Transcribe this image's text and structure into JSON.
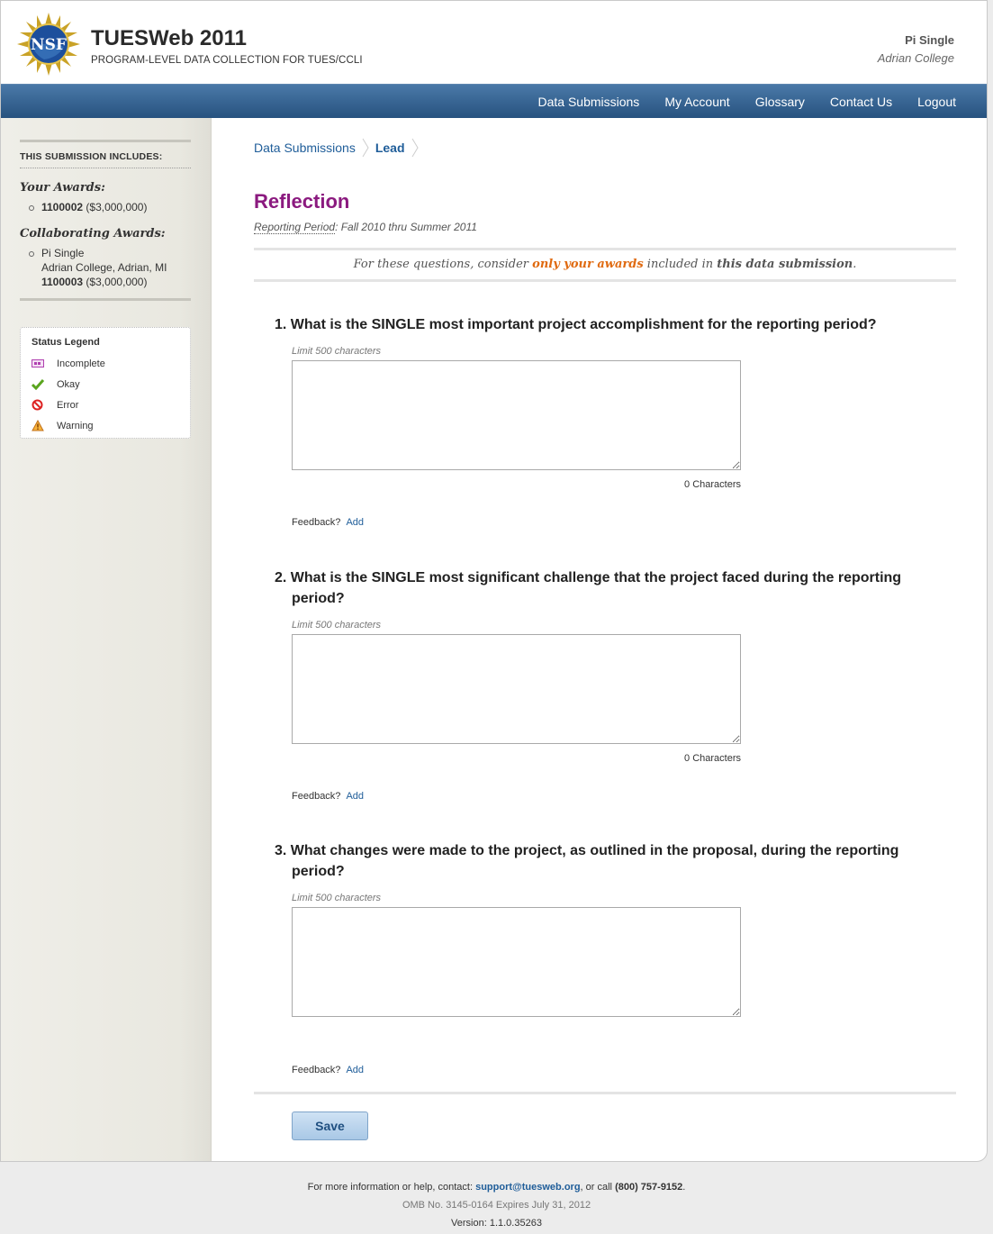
{
  "header": {
    "title": "TUESWeb 2011",
    "subtitle": "PROGRAM-LEVEL DATA COLLECTION FOR TUES/CCLI",
    "logo_text": "NSF",
    "user_name": "Pi Single",
    "user_org": "Adrian College"
  },
  "nav": {
    "items": [
      {
        "label": "Data Submissions"
      },
      {
        "label": "My Account"
      },
      {
        "label": "Glossary"
      },
      {
        "label": "Contact Us"
      },
      {
        "label": "Logout"
      }
    ]
  },
  "sidebar": {
    "heading": "THIS SUBMISSION INCLUDES:",
    "your_awards_title": "Your Awards:",
    "your_awards": [
      {
        "id": "1100002",
        "amount": "($3,000,000)"
      }
    ],
    "collab_title": "Collaborating Awards:",
    "collab_awards": [
      {
        "pi": "Pi Single",
        "location": "Adrian College, Adrian, MI",
        "id": "1100003",
        "amount": "($3,000,000)"
      }
    ],
    "legend": {
      "title": "Status Legend",
      "items": [
        {
          "label": "Incomplete",
          "icon": "incomplete-icon"
        },
        {
          "label": "Okay",
          "icon": "check-icon"
        },
        {
          "label": "Error",
          "icon": "error-icon"
        },
        {
          "label": "Warning",
          "icon": "warning-icon"
        }
      ]
    }
  },
  "breadcrumb": {
    "items": [
      {
        "label": "Data Submissions"
      },
      {
        "label": "Lead"
      }
    ]
  },
  "page": {
    "title": "Reflection",
    "period_label": "Reporting Period",
    "period_value": ": Fall 2010 thru Summer 2011",
    "notice": {
      "prefix": "For these questions, consider ",
      "highlight": "only your awards",
      "middle": " included in ",
      "emphasis": "this data submission",
      "suffix": "."
    }
  },
  "questions": [
    {
      "text": "1. What is the SINGLE most important project accomplishment for the reporting period?",
      "limit": "Limit 500 characters",
      "value": "",
      "char_count": "0 Characters",
      "feedback_label": "Feedback?",
      "feedback_action": "Add"
    },
    {
      "text": "2. What is the SINGLE most significant challenge that the project faced during the reporting period?",
      "limit": "Limit 500 characters",
      "value": "",
      "char_count": "0 Characters",
      "feedback_label": "Feedback?",
      "feedback_action": "Add"
    },
    {
      "text": "3. What changes were made to the project, as outlined in the proposal, during the reporting period?",
      "limit": "Limit 500 characters",
      "value": "",
      "char_count": "",
      "feedback_label": "Feedback?",
      "feedback_action": "Add"
    }
  ],
  "actions": {
    "save_label": "Save"
  },
  "footer": {
    "help_prefix": "For more information or help, contact: ",
    "email": "support@tuesweb.org",
    "help_middle": ", or call ",
    "phone": "(800) 757-9152",
    "help_suffix": ".",
    "omb": "OMB No. 3145-0164 Expires July 31, 2012",
    "version": "Version: 1.1.0.35263"
  },
  "colors": {
    "nav_bg": "#2f5d8c",
    "title_purple": "#8b1a7f",
    "link_blue": "#1f5d99",
    "notice_orange": "#e06a10"
  }
}
